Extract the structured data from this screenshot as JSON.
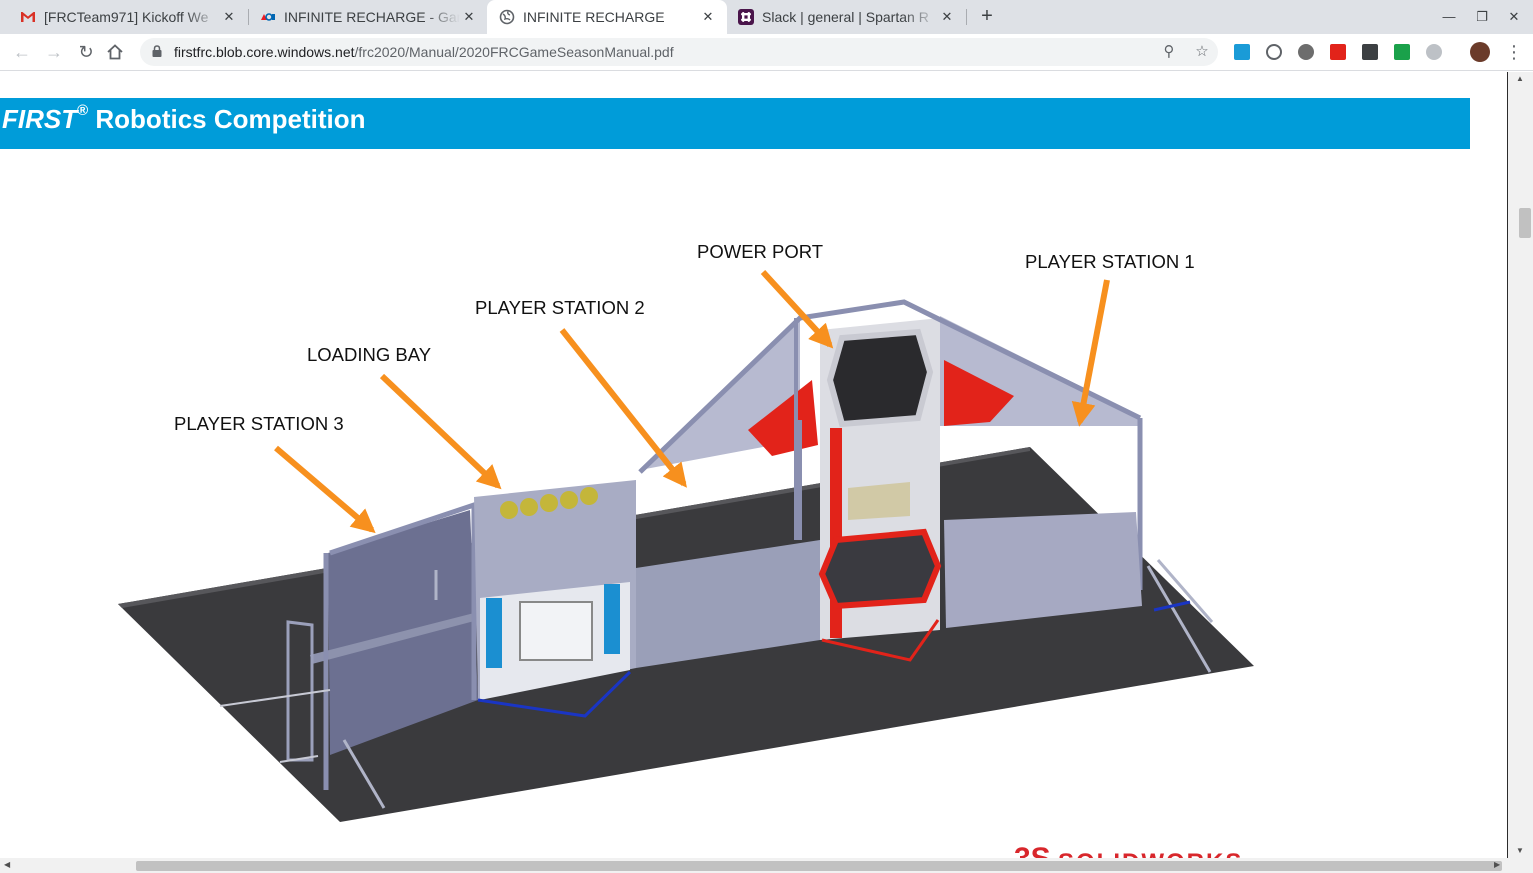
{
  "tabs": [
    {
      "title": "[FRCTeam971] Kickoff We",
      "favicon": "gmail-icon",
      "active": false
    },
    {
      "title": "INFINITE RECHARGE - Gan",
      "favicon": "first-logo-icon",
      "active": false
    },
    {
      "title": "INFINITE RECHARGE",
      "favicon": "globe-icon",
      "active": true
    },
    {
      "title": "Slack | general | Spartan R",
      "favicon": "slack-icon",
      "active": false
    }
  ],
  "toolbar": {
    "url_host": "firstfrc.blob.core.windows.net",
    "url_path": "/frc2020/Manual/2020FRCGameSeasonManual.pdf"
  },
  "document": {
    "banner_first": "FIRST",
    "banner_reg": "®",
    "banner_rest": " Robotics Competition",
    "labels": {
      "power_port": "POWER PORT",
      "player_station_1": "PLAYER STATION 1",
      "player_station_2": "PLAYER STATION 2",
      "loading_bay": "LOADING BAY",
      "player_station_3": "PLAYER STATION 3"
    },
    "logo_text": "SOLIDWORKS"
  },
  "colors": {
    "banner": "#009cd9",
    "arrow": "#f7901e",
    "field_carpet": "#3a3a3d",
    "wall": "#9a9fb8",
    "accent_red": "#e2231a"
  }
}
